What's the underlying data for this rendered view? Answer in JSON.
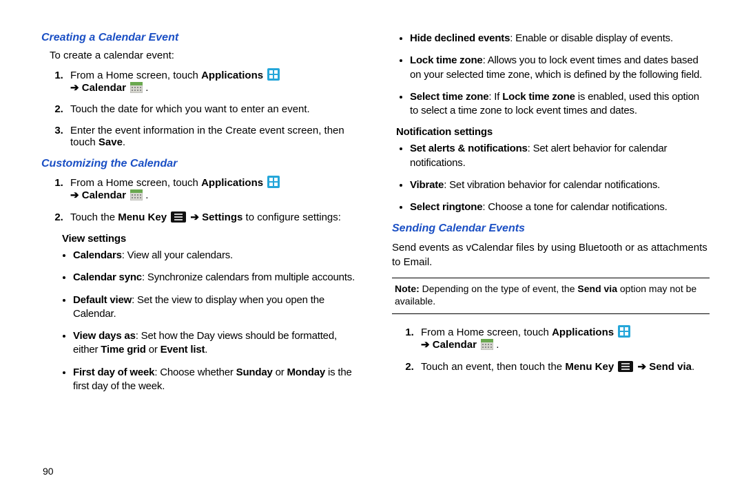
{
  "left": {
    "h1": "Creating a Calendar Event",
    "intro": "To create a calendar event:",
    "steps1": [
      {
        "pre": "From a Home screen, touch ",
        "bold": "Applications"
      },
      {
        "text": "Touch the date for which you want to enter an event."
      },
      {
        "pre": "Enter the event information in the Create event screen, then touch ",
        "bold": "Save",
        "post": "."
      }
    ],
    "calendar": "Calendar",
    "h2": "Customizing the Calendar",
    "steps2": [
      {
        "pre": "From a Home screen, touch ",
        "bold": "Applications"
      },
      {
        "partA": "Touch the ",
        "boldA": "Menu Key",
        "partB": " ",
        "boldB": "Settings",
        "partC": " to configure settings:"
      }
    ],
    "viewSettingsHead": "View settings",
    "viewSettings": [
      {
        "b": "Calendars",
        "rest": ": View all your calendars."
      },
      {
        "b": "Calendar sync",
        "rest": ": Synchronize calendars from multiple accounts."
      },
      {
        "b": "Default view",
        "rest": ": Set the view to display when you open the Calendar."
      },
      {
        "b": "View days as",
        "rest": ": Set how the Day views should be formatted, either ",
        "b2": "Time grid",
        "mid": " or ",
        "b3": "Event list",
        "end": "."
      },
      {
        "b": "First day of week",
        "rest": ": Choose whether ",
        "b2": "Sunday",
        "mid": " or ",
        "b3": "Monday",
        "end": " is the first day of the week."
      }
    ],
    "pagenum": "90"
  },
  "right": {
    "topBullets": [
      {
        "b": "Hide declined events",
        "rest": ": Enable or disable display of events."
      },
      {
        "b": "Lock time zone",
        "rest": ": Allows you to lock event times and dates based on your selected time zone, which is defined by the following field."
      },
      {
        "b": "Select time zone",
        "rest": ": If ",
        "b2": "Lock time zone",
        "mid": " is enabled, used this option to select a time zone to lock event times and dates."
      }
    ],
    "notifHead": "Notification settings",
    "notifBullets": [
      {
        "b": "Set alerts & notifications",
        "rest": ": Set alert behavior for calendar notifications."
      },
      {
        "b": "Vibrate",
        "rest": ": Set vibration behavior for calendar notifications."
      },
      {
        "b": "Select ringtone",
        "rest": ": Choose a tone for calendar notifications."
      }
    ],
    "h3": "Sending Calendar Events",
    "sendIntro": "Send events as vCalendar files by using Bluetooth or as attachments to Email.",
    "noteLabel": "Note:",
    "noteBody": " Depending on the type of event, the ",
    "noteBold": "Send via",
    "noteEnd": " option may not be available.",
    "steps3": [
      {
        "pre": "From a Home screen, touch ",
        "bold": "Applications"
      },
      {
        "pre": "Touch an event, then touch the ",
        "bold": "Menu Key",
        "post": " ",
        "bold2": "Send via",
        "end": "."
      }
    ],
    "calendar": "Calendar",
    "arrow": "➔"
  }
}
